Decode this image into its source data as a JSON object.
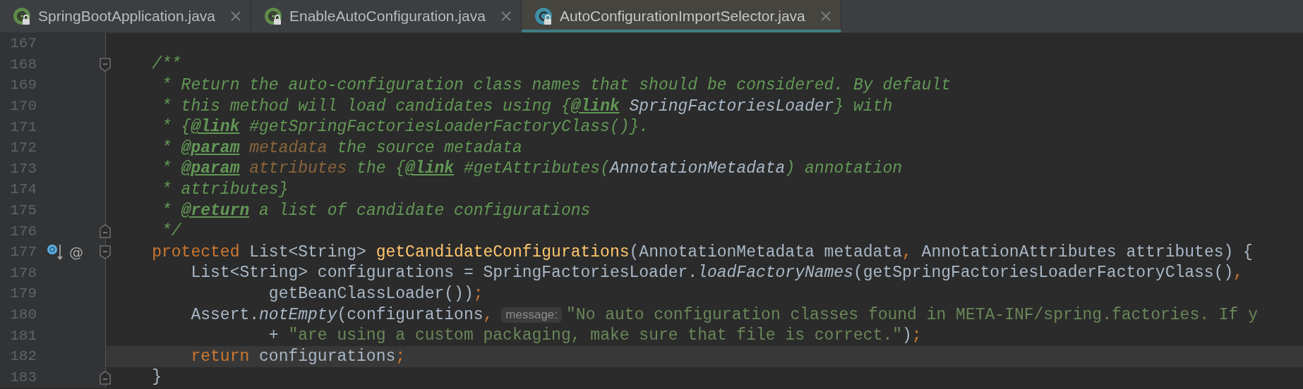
{
  "tabs": [
    {
      "label": "SpringBootApplication.java",
      "kind": "annotation",
      "selected": false
    },
    {
      "label": "EnableAutoConfiguration.java",
      "kind": "annotation",
      "selected": false
    },
    {
      "label": "AutoConfigurationImportSelector.java",
      "kind": "class",
      "selected": true
    }
  ],
  "editor": {
    "lines": [
      {
        "number": "167",
        "current": false
      },
      {
        "number": "168",
        "current": false,
        "fold": {
          "kind": "start"
        },
        "tokens": [
          {
            "kind": "comment",
            "text": "    /**"
          }
        ]
      },
      {
        "number": "169",
        "current": false,
        "tokens": [
          {
            "kind": "comment",
            "text": "     * Return the auto-configuration class names that should be considered. By default"
          }
        ]
      },
      {
        "number": "170",
        "current": false,
        "tokens": [
          {
            "kind": "comment",
            "text": "     * this method will load candidates using {"
          },
          {
            "kind": "tag",
            "text": "@link"
          },
          {
            "kind": "ref",
            "text": " SpringFactoriesLoader"
          },
          {
            "kind": "comment",
            "text": "} with"
          }
        ]
      },
      {
        "number": "171",
        "current": false,
        "tokens": [
          {
            "kind": "comment",
            "text": "     * {"
          },
          {
            "kind": "tag",
            "text": "@link"
          },
          {
            "kind": "comment",
            "text": " #getSpringFactoriesLoaderFactoryClass()}."
          }
        ]
      },
      {
        "number": "172",
        "current": false,
        "tokens": [
          {
            "kind": "comment",
            "text": "     * "
          },
          {
            "kind": "tag",
            "text": "@param"
          },
          {
            "kind": "param",
            "text": " metadata"
          },
          {
            "kind": "comment",
            "text": " the source metadata"
          }
        ]
      },
      {
        "number": "173",
        "current": false,
        "tokens": [
          {
            "kind": "comment",
            "text": "     * "
          },
          {
            "kind": "tag",
            "text": "@param"
          },
          {
            "kind": "param",
            "text": " attributes"
          },
          {
            "kind": "comment",
            "text": " the {"
          },
          {
            "kind": "tag",
            "text": "@link"
          },
          {
            "kind": "comment",
            "text": " #getAttributes("
          },
          {
            "kind": "ref",
            "text": "AnnotationMetadata"
          },
          {
            "kind": "comment",
            "text": ") annotation"
          }
        ]
      },
      {
        "number": "174",
        "current": false,
        "tokens": [
          {
            "kind": "comment",
            "text": "     * attributes}"
          }
        ]
      },
      {
        "number": "175",
        "current": false,
        "tokens": [
          {
            "kind": "comment",
            "text": "     * "
          },
          {
            "kind": "tag",
            "text": "@return"
          },
          {
            "kind": "comment",
            "text": " a list of candidate configurations"
          }
        ]
      },
      {
        "number": "176",
        "current": false,
        "fold": {
          "kind": "end"
        },
        "tokens": [
          {
            "kind": "comment",
            "text": "     */"
          }
        ]
      },
      {
        "number": "177",
        "current": false,
        "fold": {
          "kind": "start"
        },
        "gutter_icons": [
          {
            "kind": "override"
          },
          {
            "kind": "annotation",
            "text": "@"
          }
        ],
        "tokens": [
          {
            "kind": "keyword",
            "text": "    protected"
          },
          {
            "kind": "plain",
            "text": " List<String> "
          },
          {
            "kind": "method",
            "text": "getCandidateConfigurations"
          },
          {
            "kind": "plain",
            "text": "(AnnotationMetadata metadata"
          },
          {
            "kind": "punct",
            "text": ","
          },
          {
            "kind": "plain",
            "text": " AnnotationAttributes attributes) {"
          }
        ]
      },
      {
        "number": "178",
        "current": false,
        "tokens": [
          {
            "kind": "plain",
            "text": "        List<String> configurations = SpringFactoriesLoader."
          },
          {
            "kind": "static",
            "text": "loadFactoryNames"
          },
          {
            "kind": "plain",
            "text": "(getSpringFactoriesLoaderFactoryClass()"
          },
          {
            "kind": "punct",
            "text": ","
          }
        ]
      },
      {
        "number": "179",
        "current": false,
        "tokens": [
          {
            "kind": "plain",
            "text": "                getBeanClassLoader())"
          },
          {
            "kind": "punct",
            "text": ";"
          }
        ]
      },
      {
        "number": "180",
        "current": false,
        "tokens": [
          {
            "kind": "plain",
            "text": "        Assert."
          },
          {
            "kind": "static",
            "text": "notEmpty"
          },
          {
            "kind": "plain",
            "text": "(configurations"
          },
          {
            "kind": "punct",
            "text": ","
          },
          {
            "kind": "hint",
            "text": "message:"
          },
          {
            "kind": "string",
            "text": "\"No auto configuration classes found in META-INF/spring.factories. If y"
          }
        ]
      },
      {
        "number": "181",
        "current": false,
        "tokens": [
          {
            "kind": "plain",
            "text": "                + "
          },
          {
            "kind": "string",
            "text": "\"are using a custom packaging, make sure that file is correct.\""
          },
          {
            "kind": "plain",
            "text": ")"
          },
          {
            "kind": "punct",
            "text": ";"
          }
        ]
      },
      {
        "number": "182",
        "current": true,
        "tokens": [
          {
            "kind": "keyword",
            "text": "        return"
          },
          {
            "kind": "plain",
            "text": " configurations"
          },
          {
            "kind": "punct",
            "text": ";"
          }
        ]
      },
      {
        "number": "183",
        "current": false,
        "fold": {
          "kind": "end"
        },
        "tokens": [
          {
            "kind": "plain",
            "text": "    }"
          }
        ]
      }
    ]
  }
}
